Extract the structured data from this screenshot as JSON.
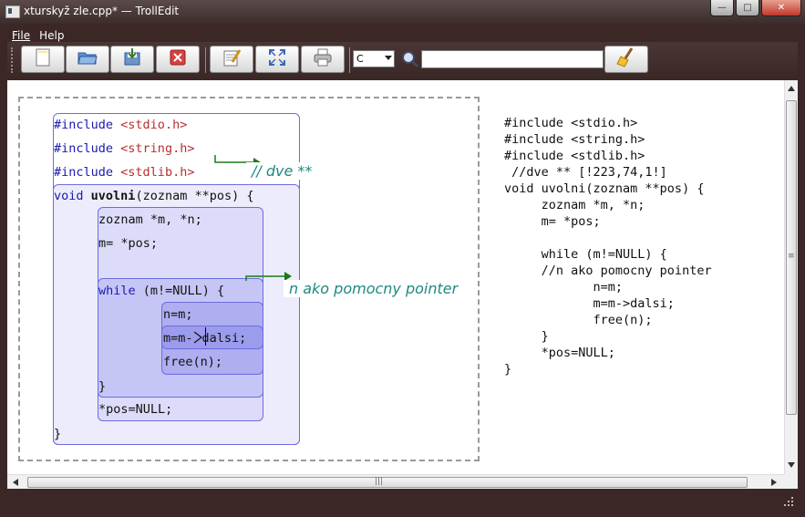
{
  "window": {
    "title": "xturskyž zle.cpp* — TrollEdit",
    "controls": {
      "minimize": "—",
      "maximize": "□",
      "close": "✕"
    }
  },
  "menu": {
    "file": "File",
    "help": "Help"
  },
  "toolbar": {
    "buttons": [
      {
        "name": "new-file-button",
        "icon": "new-document-icon"
      },
      {
        "name": "open-file-button",
        "icon": "folder-icon"
      },
      {
        "name": "save-file-button",
        "icon": "save-icon"
      },
      {
        "name": "close-file-button",
        "icon": "close-document-icon"
      },
      {
        "name": "edit-button",
        "icon": "notepad-icon"
      },
      {
        "name": "fullscreen-button",
        "icon": "fullscreen-icon"
      },
      {
        "name": "print-button",
        "icon": "printer-icon"
      },
      {
        "name": "clean-button",
        "icon": "broom-icon"
      }
    ],
    "language": "C",
    "search_value": ""
  },
  "graphical": {
    "includes": [
      {
        "kw": "#include",
        "file": "<stdio.h>"
      },
      {
        "kw": "#include",
        "file": "<string.h>"
      },
      {
        "kw": "#include",
        "file": "<stdlib.h>"
      }
    ],
    "comment1": "// dve **",
    "func_kw": "void",
    "func_name": "uvolni",
    "func_params": "(zoznam **pos) {",
    "decl": "zoznam *m, *n;",
    "assign": "m= *pos;",
    "while_kw": "while",
    "while_cond": " (m!=NULL) {",
    "comment2": "n ako pomocny pointer",
    "stmt1": "n=m;",
    "stmt2_a": "m=m-",
    "stmt2_b": "dalsi;",
    "stmt3": "free(n);",
    "close_while": "}",
    "final": "*pos=NULL;",
    "close_func": "}"
  },
  "text_view": {
    "lines": [
      "#include <stdio.h>",
      "#include <string.h>",
      "#include <stdlib.h>",
      " //dve ** [!223,74,1!]",
      "void uvolni(zoznam **pos) {",
      "     zoznam *m, *n;",
      "     m= *pos;",
      "",
      "     while (m!=NULL) {",
      "     //n ako pomocny pointer",
      "            n=m;",
      "            m=m->dalsi;",
      "            free(n);",
      "     }",
      "     *pos=NULL;",
      "}"
    ]
  },
  "scrollbar": {
    "grip": "≡",
    "hgrip": "|||"
  }
}
